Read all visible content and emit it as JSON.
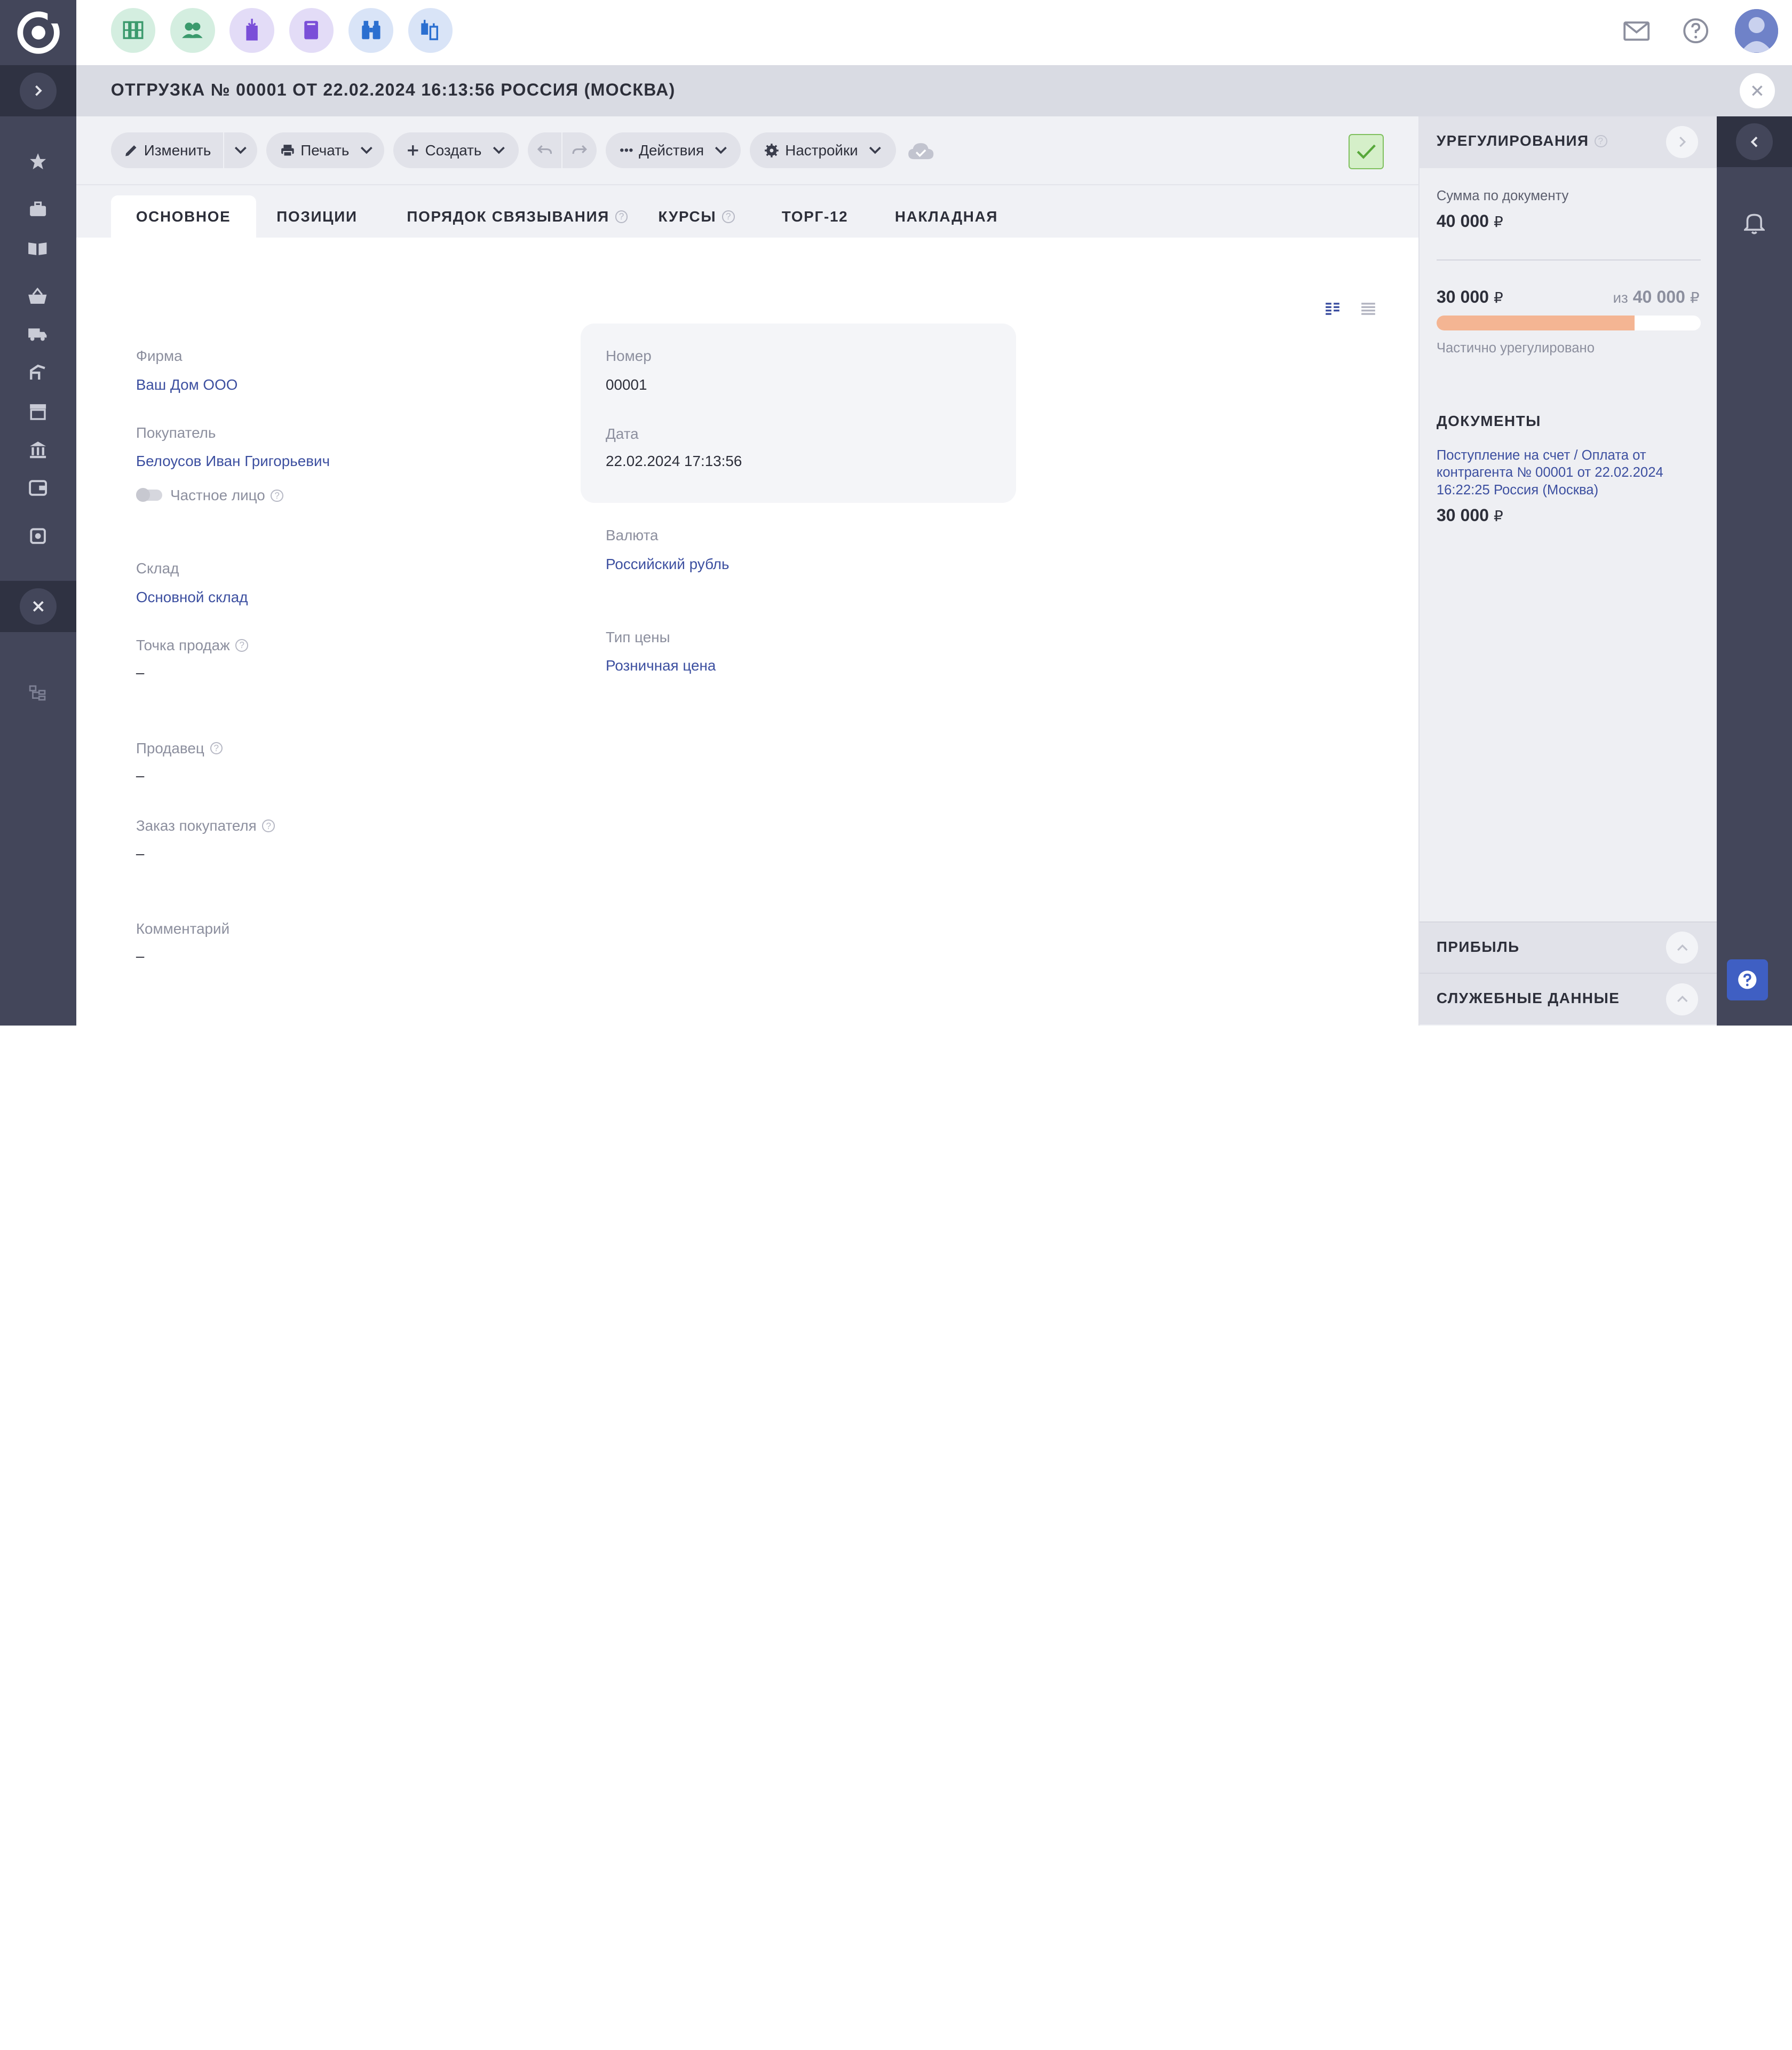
{
  "header": {
    "title": "ОТГРУЗКА № 00001 ОТ 22.02.2024 16:13:56 РОССИЯ (МОСКВА)"
  },
  "top_apps": [
    {
      "icon": "warehouse-icon",
      "bg": "#d4eee0"
    },
    {
      "icon": "contacts-icon",
      "bg": "#d4eee0"
    },
    {
      "icon": "finance-document-icon",
      "bg": "#e3dcf7"
    },
    {
      "icon": "book-icon",
      "bg": "#e3dcf7"
    },
    {
      "icon": "binoculars-icon",
      "bg": "#d9e4f7"
    },
    {
      "icon": "transfer-icon",
      "bg": "#d9e4f7"
    }
  ],
  "toolbar": {
    "edit_label": "Изменить",
    "print_label": "Печать",
    "create_label": "Создать",
    "actions_label": "Действия",
    "settings_label": "Настройки"
  },
  "tabs": [
    {
      "label": "ОСНОВНОЕ",
      "active": true
    },
    {
      "label": "ПОЗИЦИИ"
    },
    {
      "label": "ПОРЯДОК СВЯЗЫВАНИЯ",
      "help": true
    },
    {
      "label": "КУРСЫ",
      "help": true
    },
    {
      "label": "ТОРГ-12"
    },
    {
      "label": "НАКЛАДНАЯ"
    }
  ],
  "form": {
    "firm_label": "Фирма",
    "firm_value": "Ваш Дом ООО",
    "buyer_label": "Покупатель",
    "buyer_value": "Белоусов Иван Григорьевич",
    "private_person_label": "Частное лицо",
    "number_label": "Номер",
    "number_value": "00001",
    "date_label": "Дата",
    "date_value": "22.02.2024 17:13:56",
    "warehouse_label": "Склад",
    "warehouse_value": "Основной склад",
    "currency_label": "Валюта",
    "currency_value": "Российский рубль",
    "point_of_sale_label": "Точка продаж",
    "point_of_sale_value": "–",
    "price_type_label": "Тип цены",
    "price_type_value": "Розничная цена",
    "seller_label": "Продавец",
    "seller_value": "–",
    "customer_order_label": "Заказ покупателя",
    "customer_order_value": "–",
    "comment_label": "Комментарий",
    "comment_value": "–"
  },
  "settlements": {
    "title": "УРЕГУЛИРОВАНИЯ",
    "doc_sum_label": "Сумма по документу",
    "doc_sum_value": "40 000",
    "settled_value": "30 000",
    "of_label": "из",
    "of_value": "40 000",
    "currency_sign": "₽",
    "progress_fraction": 0.75,
    "status_text": "Частично урегулировано",
    "documents_title": "ДОКУМЕНТЫ",
    "document_link": "Поступление на счет / Оплата от контрагента № 00001 от 22.02.2024 16:22:25 Россия (Москва)",
    "document_amount": "30 000",
    "profit_title": "ПРИБЫЛЬ",
    "service_data_title": "СЛУЖЕБНЫЕ ДАННЫЕ"
  },
  "colors": {
    "sidebar": "#43465a",
    "sidebar_dark": "#2f3242",
    "link": "#3c4fa0",
    "progress": "#f4b593",
    "ok_border": "#7fc05e",
    "help_fab": "#3f5fc3"
  }
}
